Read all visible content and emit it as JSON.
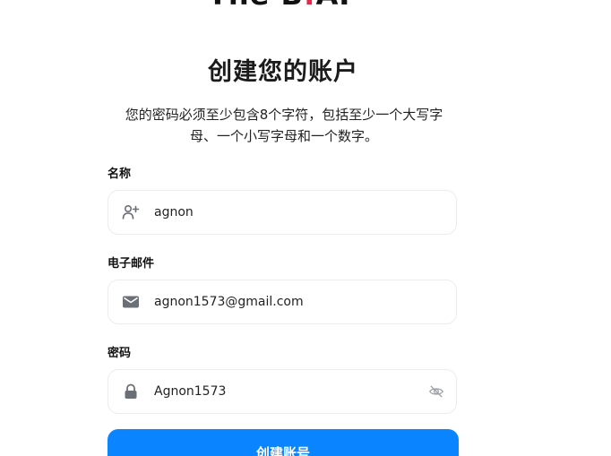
{
  "logo": {
    "text_before_dot": "The B",
    "dot": ":",
    "text_after_dot": "AI",
    "dot_color": "#e8274b"
  },
  "title": "创建您的账户",
  "subtitle": "您的密码必须至少包含8个字符，包括至少一个大写字母、一个小写字母和一个数字。",
  "form": {
    "name": {
      "label": "名称",
      "value": "agnon",
      "icon": "add-user-icon"
    },
    "email": {
      "label": "电子邮件",
      "value": "agnon1573@gmail.com",
      "icon": "mail-icon"
    },
    "password": {
      "label": "密码",
      "value": "Agnon1573",
      "icon": "lock-icon",
      "toggle_icon": "eye-off-icon"
    },
    "submit_label": "创建账号"
  },
  "colors": {
    "accent": "#0a84ff",
    "field_border": "#ececec",
    "icon": "#6b6f76"
  }
}
